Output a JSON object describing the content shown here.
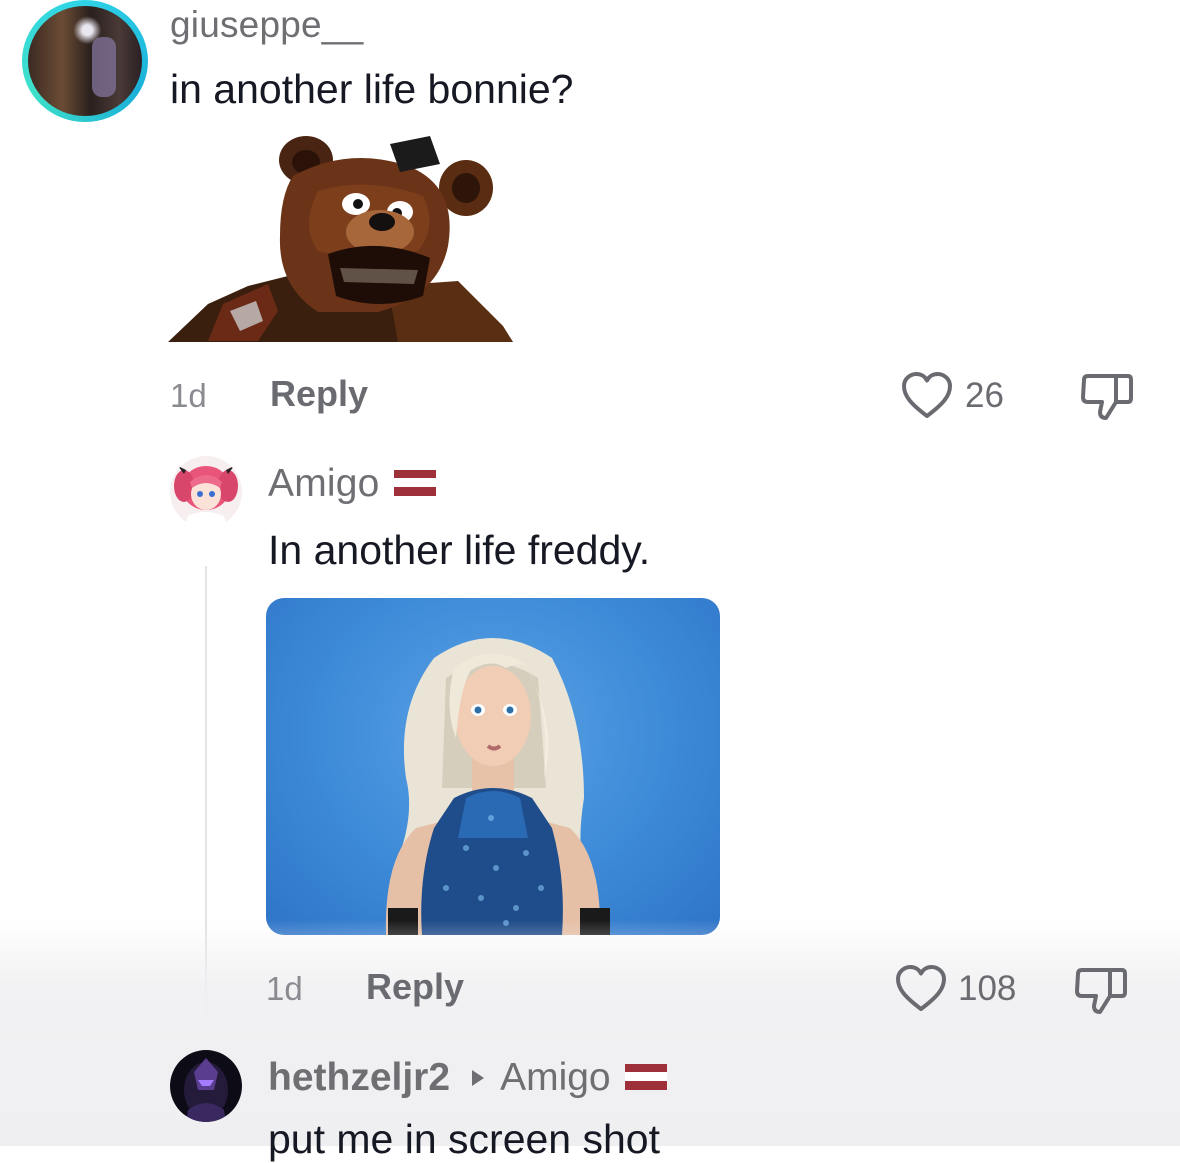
{
  "comments": [
    {
      "username": "giuseppe__",
      "text": "in another life bonnie?",
      "time": "1d",
      "reply_label": "Reply",
      "likes": "26"
    },
    {
      "username": "Amigo",
      "text": "In another life freddy.",
      "time": "1d",
      "reply_label": "Reply",
      "likes": "108"
    },
    {
      "username": "hethzeljr2",
      "reply_to": "Amigo",
      "text": "put me in screen shot"
    }
  ],
  "icons": {
    "like": "heart-outline-icon",
    "dislike": "thumbs-down-icon",
    "reply_arrow": "triangle-right-icon",
    "flag": "latvia-flag-icon"
  },
  "colors": {
    "text_primary": "#161823",
    "text_secondary": "#6a6b70",
    "avatar_ring": "#2fd3e8",
    "flag_red": "#9e3039",
    "photo_bg": "#3d8ad8"
  }
}
